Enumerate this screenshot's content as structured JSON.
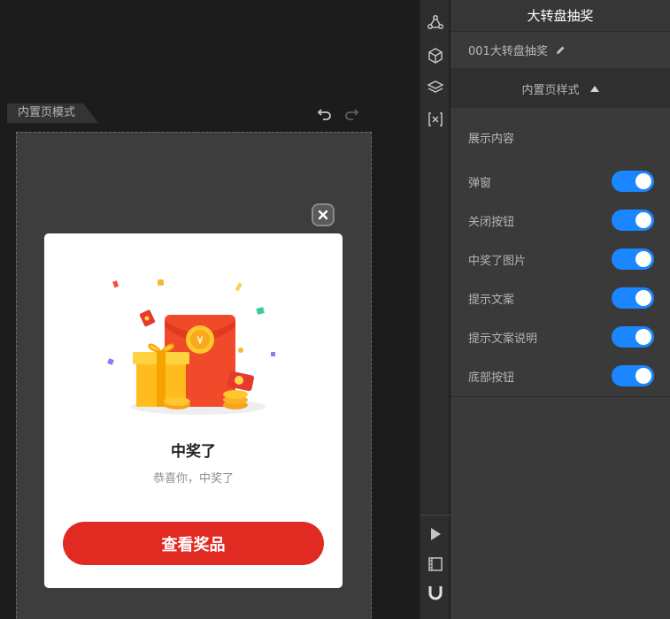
{
  "canvas": {
    "mode_label": "内置页模式"
  },
  "popup": {
    "title": "中奖了",
    "subtitle": "恭喜你，中奖了",
    "button_label": "查看奖品"
  },
  "panel": {
    "header_title": "大转盘抽奖",
    "component_name": "001大转盘抽奖",
    "section_label": "内置页样式",
    "content_title": "展示内容",
    "options": [
      {
        "label": "弹窗",
        "enabled": true
      },
      {
        "label": "关闭按钮",
        "enabled": true
      },
      {
        "label": "中奖了图片",
        "enabled": true
      },
      {
        "label": "提示文案",
        "enabled": true
      },
      {
        "label": "提示文案说明",
        "enabled": true
      },
      {
        "label": "底部按钮",
        "enabled": true
      }
    ]
  },
  "toolbar": {
    "icons": [
      "components-icon",
      "cube-icon",
      "layers-icon",
      "variable-icon",
      "play-icon",
      "film-icon",
      "magnet-icon"
    ]
  },
  "colors": {
    "toggle_on": "#1a86ff",
    "cta": "#e02a22"
  }
}
